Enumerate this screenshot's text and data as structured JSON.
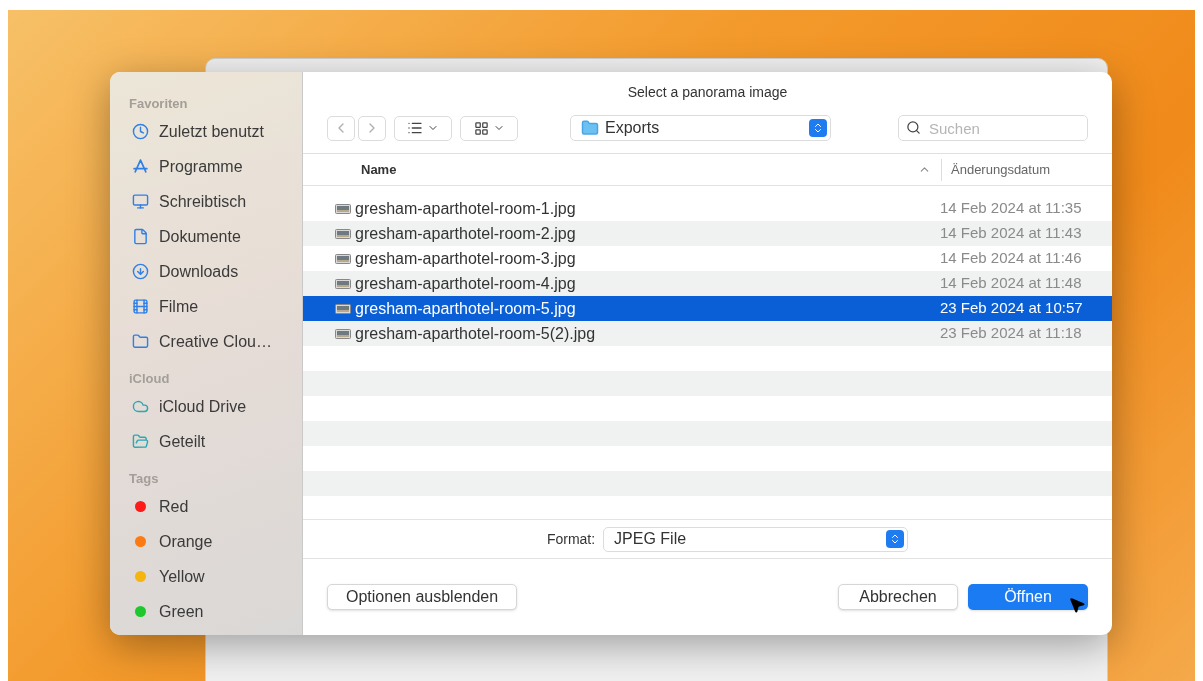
{
  "dialog": {
    "title": "Select a panorama image"
  },
  "sidebar": {
    "sections": [
      {
        "heading": "Favoriten",
        "items": [
          {
            "kind": "recent",
            "label": "Zuletzt benutzt"
          },
          {
            "kind": "apps",
            "label": "Programme"
          },
          {
            "kind": "desktop",
            "label": "Schreibtisch"
          },
          {
            "kind": "document",
            "label": "Dokumente"
          },
          {
            "kind": "download",
            "label": "Downloads"
          },
          {
            "kind": "film",
            "label": "Filme"
          },
          {
            "kind": "folder",
            "label": "Creative Clou…"
          }
        ]
      },
      {
        "heading": "iCloud",
        "items": [
          {
            "kind": "cloud",
            "label": "iCloud Drive"
          },
          {
            "kind": "shared",
            "label": "Geteilt"
          }
        ]
      },
      {
        "heading": "Tags",
        "items": [
          {
            "kind": "tag",
            "label": "Red",
            "color": "#ff1a1a"
          },
          {
            "kind": "tag",
            "label": "Orange",
            "color": "#fb7a13"
          },
          {
            "kind": "tag",
            "label": "Yellow",
            "color": "#f6b40e"
          },
          {
            "kind": "tag",
            "label": "Green",
            "color": "#1fc72e"
          }
        ]
      }
    ]
  },
  "toolbar": {
    "location": "Exports",
    "search": {
      "placeholder": "Suchen"
    }
  },
  "table": {
    "columns": [
      "Name",
      "Änderungsdatum"
    ],
    "rows": [
      {
        "name": "gresham-aparthotel-room-1.jpg",
        "date": "14 Feb 2024 at 11:35",
        "selected": false
      },
      {
        "name": "gresham-aparthotel-room-2.jpg",
        "date": "14 Feb 2024 at 11:43",
        "selected": false
      },
      {
        "name": "gresham-aparthotel-room-3.jpg",
        "date": "14 Feb 2024 at 11:46",
        "selected": false
      },
      {
        "name": "gresham-aparthotel-room-4.jpg",
        "date": "14 Feb 2024 at 11:48",
        "selected": false
      },
      {
        "name": "gresham-aparthotel-room-5.jpg",
        "date": "23 Feb 2024 at 10:57",
        "selected": true
      },
      {
        "name": "gresham-aparthotel-room-5(2).jpg",
        "date": "23 Feb 2024 at 11:18",
        "selected": false
      }
    ]
  },
  "format": {
    "label": "Format:",
    "value": "JPEG File"
  },
  "buttons": {
    "options": "Optionen ausblenden",
    "cancel": "Abbrechen",
    "open": "Öffnen"
  }
}
